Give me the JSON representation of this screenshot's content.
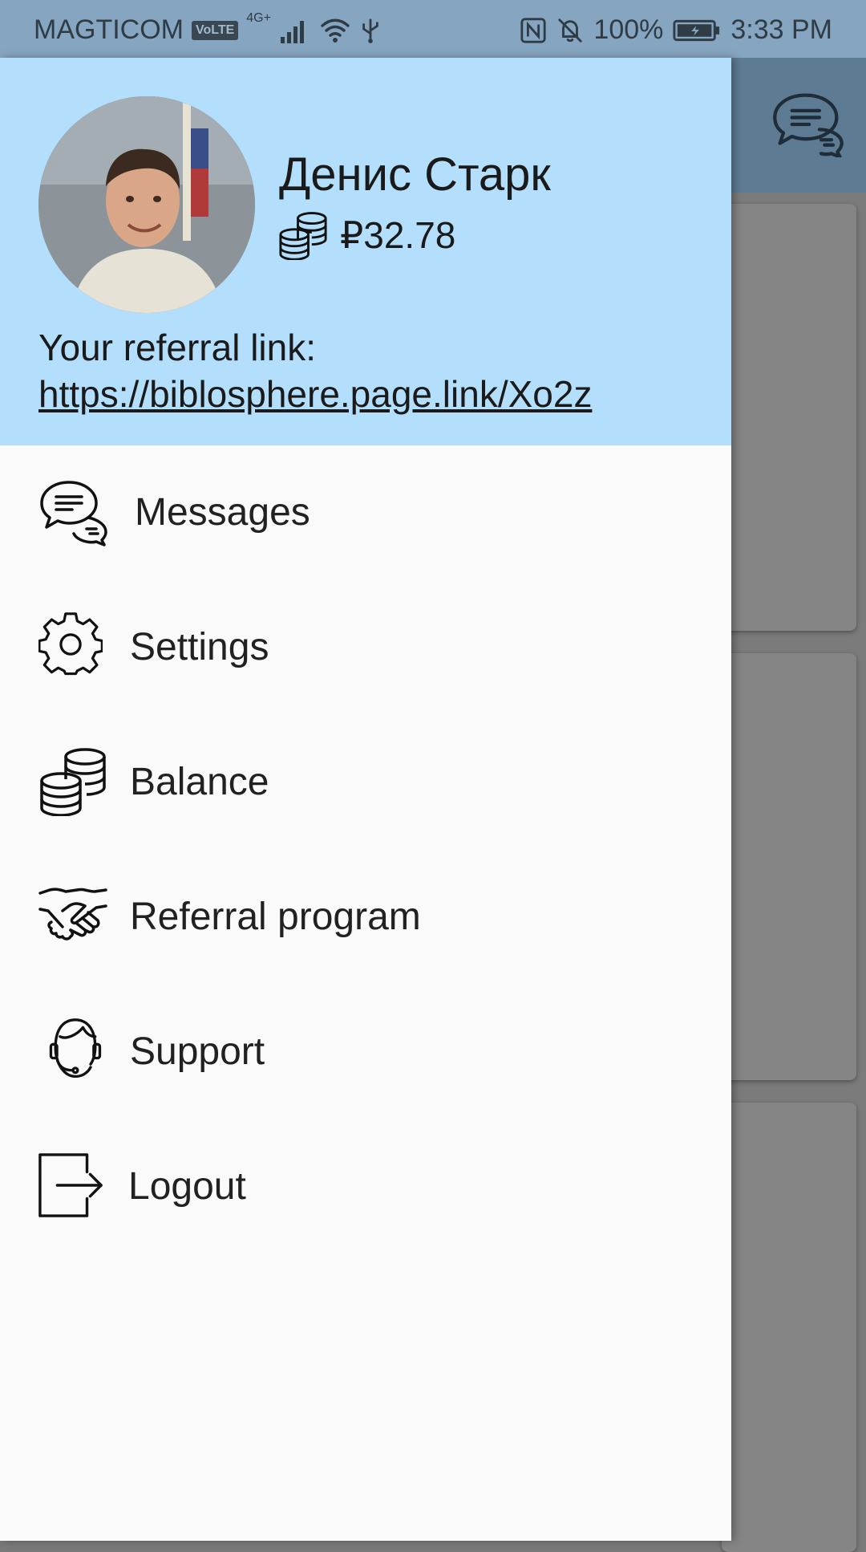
{
  "status_bar": {
    "carrier": "MAGTICOM",
    "volte": "VoLTE",
    "network": "4G+",
    "battery": "100%",
    "time": "3:33 PM"
  },
  "drawer": {
    "user_name": "Денис Старк",
    "balance": "₽32.78",
    "referral_label": "Your referral link:",
    "referral_link": "https://biblosphere.page.link/Xo2z",
    "menu": [
      {
        "label": "Messages",
        "icon": "chat-bubbles-icon"
      },
      {
        "label": "Settings",
        "icon": "gear-icon"
      },
      {
        "label": "Balance",
        "icon": "coins-icon"
      },
      {
        "label": "Referral program",
        "icon": "handshake-icon"
      },
      {
        "label": "Support",
        "icon": "headset-icon"
      },
      {
        "label": "Logout",
        "icon": "logout-icon"
      }
    ]
  },
  "colors": {
    "header_bg": "#b3defc",
    "statusbar_bg": "#86a5c0",
    "drawer_bg": "#fafafa"
  }
}
